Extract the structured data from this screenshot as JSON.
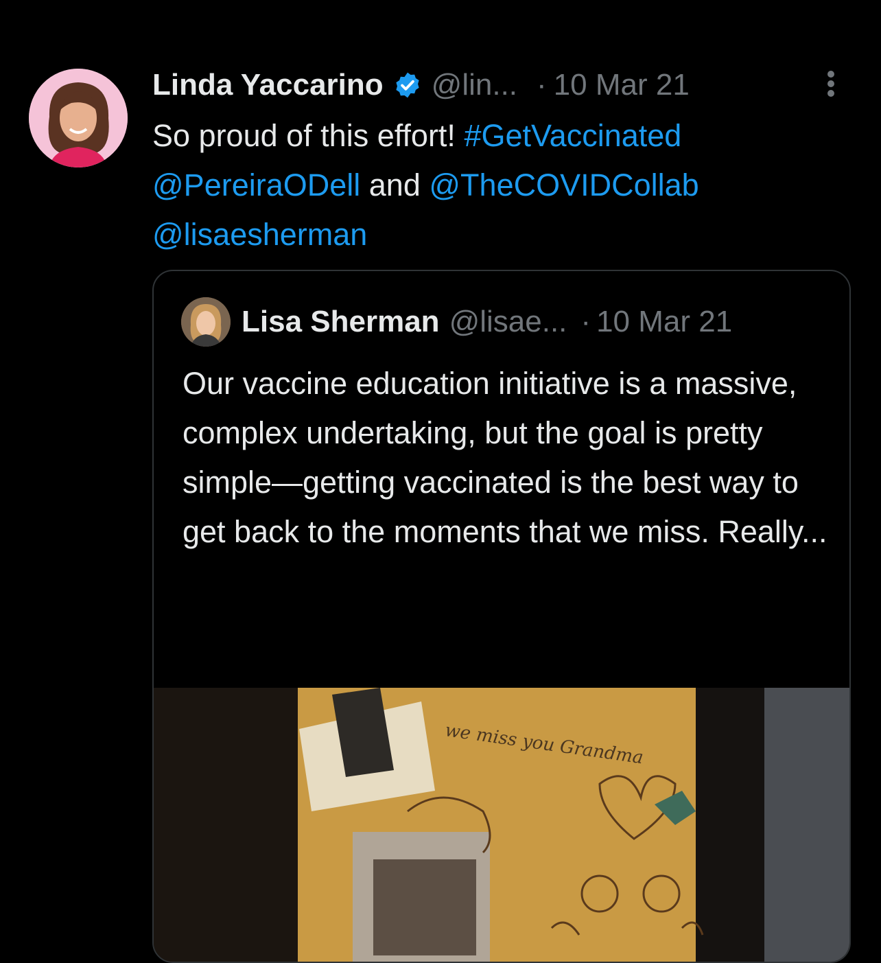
{
  "tweet": {
    "author_name": "Linda Yaccarino",
    "handle": "@lin...",
    "separator": "·",
    "date": "10 Mar 21",
    "text_plain_1": "So proud of this effort! ",
    "hashtag": "#GetVaccinated",
    "mention_1": "@PereiraODell",
    "text_plain_2": " and ",
    "mention_2": "@TheCOVIDCollab",
    "mention_3": "@lisaesherman"
  },
  "quoted_tweet": {
    "author_name": "Lisa Sherman",
    "handle": "@lisae...",
    "separator": "·",
    "date": "10 Mar 21",
    "text": "Our vaccine education initiative is a massive, complex undertaking, but the goal is pretty simple—getting vaccinated is the best way to get back to the moments that we miss. Really...",
    "media_drawing_text": "we miss you Grandma"
  },
  "colors": {
    "background": "#000000",
    "text": "#e7e9ea",
    "secondary": "#71767b",
    "link": "#1d9bf0",
    "border": "#2f3336",
    "verified": "#1d9bf0"
  },
  "icons": [
    "verified-badge-icon",
    "more-options-icon"
  ]
}
